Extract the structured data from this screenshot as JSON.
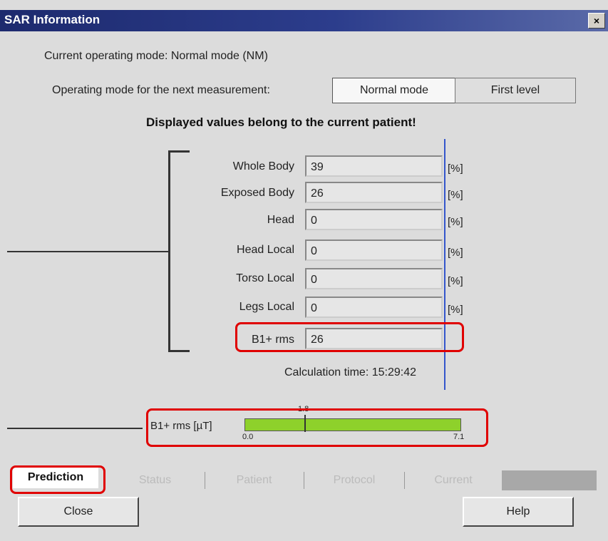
{
  "window": {
    "title": "SAR Information",
    "close_glyph": "×"
  },
  "mode": {
    "current_text": "Current operating mode: Normal mode (NM)",
    "next_label": "Operating mode for the next measurement",
    "options": [
      "Normal mode",
      "First level"
    ]
  },
  "warning": "Displayed values belong to the current patient!",
  "sar_rows": [
    {
      "label": "Whole Body",
      "value": "39",
      "unit": "[%]"
    },
    {
      "label": "Exposed Body",
      "value": "26",
      "unit": "[%]"
    },
    {
      "label": "Head",
      "value": "0",
      "unit": "[%]"
    },
    {
      "label": "Head Local",
      "value": "0",
      "unit": "[%]"
    },
    {
      "label": "Torso Local",
      "value": "0",
      "unit": "[%]"
    },
    {
      "label": "Legs Local",
      "value": "0",
      "unit": "[%]"
    },
    {
      "label": "B1+ rms",
      "value": "26",
      "unit": ""
    }
  ],
  "calculation_time": "Calculation time: 15:29:42",
  "b1_gauge": {
    "label": "B1+ rms [µT]",
    "min": "0.0",
    "max": "7.1",
    "current": "1.8",
    "current_value": 1.8,
    "fill_fraction": 1.0,
    "color": "#8ed12b"
  },
  "tabs": [
    "Prediction",
    "Status",
    "Patient",
    "Protocol",
    "Current"
  ],
  "buttons": {
    "close": "Close",
    "help": "Help"
  },
  "colors": {
    "titlebar": "#1d2a6e",
    "highlight": "#e00000",
    "divider": "#3355cc"
  }
}
